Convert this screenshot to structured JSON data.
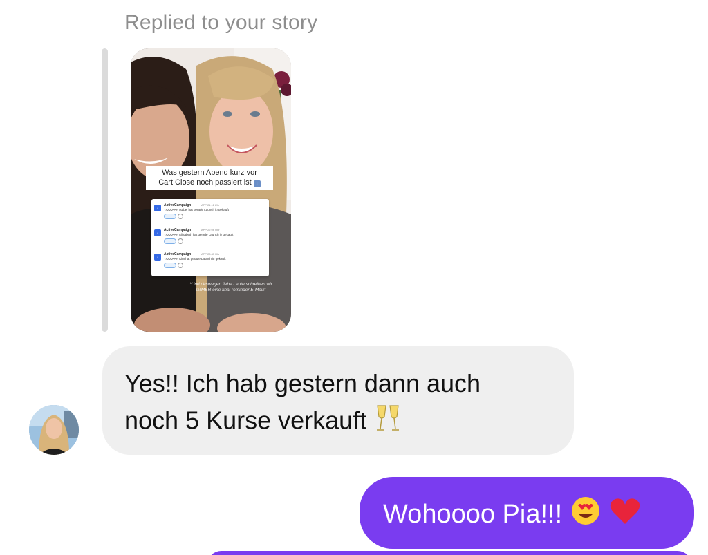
{
  "reply_label": "Replied to your story",
  "story": {
    "caption_line1": "Was gestern Abend kurz vor",
    "caption_line2": "Cart Close noch passiert ist",
    "notifications": [
      {
        "app": "ActiveCampaign",
        "tag": "APP",
        "time": "21:11 Uhr",
        "text": "YAAAAAY, Isabel hat gerade Launch it! gekauft"
      },
      {
        "app": "ActiveCampaign",
        "tag": "APP",
        "time": "22:06 Uhr",
        "text": "YAAAAAY, Elisabeth hat gerade Launch it! gekauft"
      },
      {
        "app": "ActiveCampaign",
        "tag": "APP",
        "time": "23:45 Uhr",
        "text": "YAAAAAY, Kim hat gerade Launch it! gekauft"
      }
    ],
    "footnote_line1": "*Und deswegen liebe Leute schreiben wir",
    "footnote_line2": "IMMER eine final reminder E-Mail!!"
  },
  "messages": {
    "incoming_line1": "Yes!! Ich hab gestern dann auch",
    "incoming_line2": "noch 5 Kurse verkauft",
    "outgoing_text": "Wohoooo Pia!!!"
  },
  "colors": {
    "outgoing_bubble": "#7a3cf0",
    "incoming_bubble": "#efefef",
    "reply_label": "#8e8e8e"
  },
  "icons": {
    "incoming_emoji": "champagne-glasses-icon",
    "outgoing_emoji_1": "heart-eyes-face-icon",
    "outgoing_emoji_2": "red-heart-icon"
  }
}
